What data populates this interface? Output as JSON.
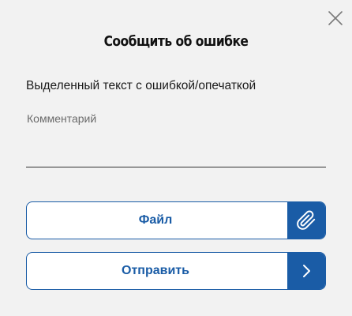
{
  "dialog": {
    "title": "Сообщить об ошибке",
    "selected_text": "Выделенный текст с ошибкой/опечаткой",
    "comment": {
      "placeholder": "Комментарий",
      "value": ""
    },
    "file_button": {
      "label": "Файл",
      "icon": "paperclip-icon"
    },
    "send_button": {
      "label": "Отправить",
      "icon": "chevron-right-icon"
    },
    "close_icon": "close-icon"
  },
  "colors": {
    "background": "#f2f2f2",
    "accent": "#1a5ca6",
    "button_fill": "#ffffff",
    "text": "#111111"
  }
}
